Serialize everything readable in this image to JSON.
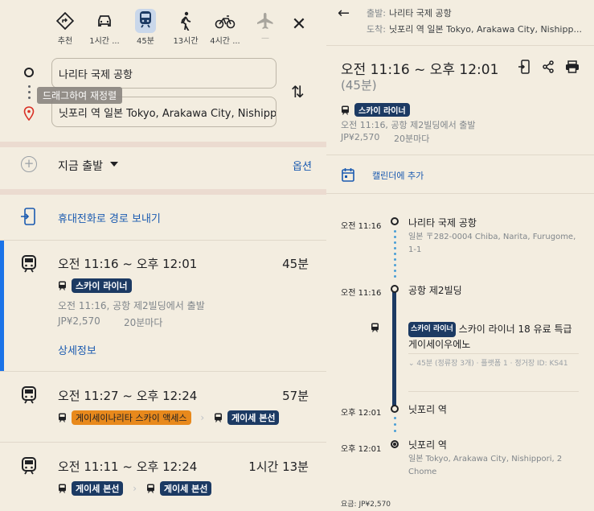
{
  "modes": [
    {
      "label": "추천",
      "icon": "diamond-directions-icon"
    },
    {
      "label": "1시간 ...",
      "icon": "car-icon"
    },
    {
      "label": "45분",
      "icon": "transit-icon"
    },
    {
      "label": "13시간",
      "icon": "walk-icon"
    },
    {
      "label": "4시간 ...",
      "icon": "bike-icon"
    },
    {
      "label": "—",
      "icon": "flight-icon"
    }
  ],
  "inputs": {
    "origin": "나리타 국제 공항",
    "destination": "닛포리 역 일본 Tokyo, Arakawa City, Nishippori, 2 Chome",
    "drag_tooltip": "드래그하여 재정렬"
  },
  "depart": {
    "label": "지금 출발",
    "options": "옵션"
  },
  "send_to_phone": "휴대전화로 경로 보내기",
  "routes": [
    {
      "time": "오전 11:16 ~ 오후 12:01",
      "duration": "45분",
      "lines": [
        {
          "name": "스카이 라이너",
          "color": "navy"
        }
      ],
      "sub": "오전 11:16, 공항 제2빌딩에서 출발",
      "fare": "JP¥2,570",
      "freq": "20분마다",
      "details": "상세정보"
    },
    {
      "time": "오전 11:27 ~ 오후 12:24",
      "duration": "57분",
      "lines": [
        {
          "name": "게이세이나리타 스카이 액세스",
          "color": "orange"
        },
        {
          "name": "게이세 본선",
          "color": "navy"
        }
      ]
    },
    {
      "time": "오전 11:11 ~ 오후 12:24",
      "duration": "1시간 13분",
      "lines": [
        {
          "name": "게이세 본선",
          "color": "navy"
        },
        {
          "name": "게이세 본선",
          "color": "navy"
        }
      ]
    }
  ],
  "detail": {
    "from_key": "출발:",
    "from": "나리타 국제 공항",
    "to_key": "도착:",
    "to": "닛포리 역 일본 Tokyo, Arakawa City, Nishipp...",
    "time": "오전 11:16 ~ 오후 12:01",
    "duration": "(45분)",
    "line": "스카이 라이너",
    "sub": "오전 11:16, 공항 제2빌딩에서 출발",
    "fare": "JP¥2,570",
    "freq": "20분마다",
    "calendar": "캘린더에 추가",
    "stops": [
      {
        "time": "오전 11:16",
        "name": "나리타 국제 공항",
        "addr": "일본 〒282-0004 Chiba, Narita, Furugome, 1-1"
      },
      {
        "time": "오전 11:16",
        "name": "공항 제2빌딩",
        "addr": ""
      },
      {
        "time": "오후 12:01",
        "name": "닛포리 역",
        "addr": ""
      },
      {
        "time": "오후 12:01",
        "name": "닛포리 역",
        "addr": "일본 Tokyo, Arakawa City, Nishippori, 2 Chome"
      }
    ],
    "segment_chip": "스카이 라이너",
    "segment_text": "스카이 라이너 18 유료 특급 게이세이우에노",
    "segment_sub": "45분 (정류장 3개) · 플랫폼 1 · 정거장 ID: KS41",
    "total_fare": "요금: JP¥2,570"
  },
  "colors": {
    "accent": "#1a73e8",
    "navy_chip": "#1c3a63",
    "orange_chip": "#e8891c",
    "background": "#f3ede0"
  }
}
